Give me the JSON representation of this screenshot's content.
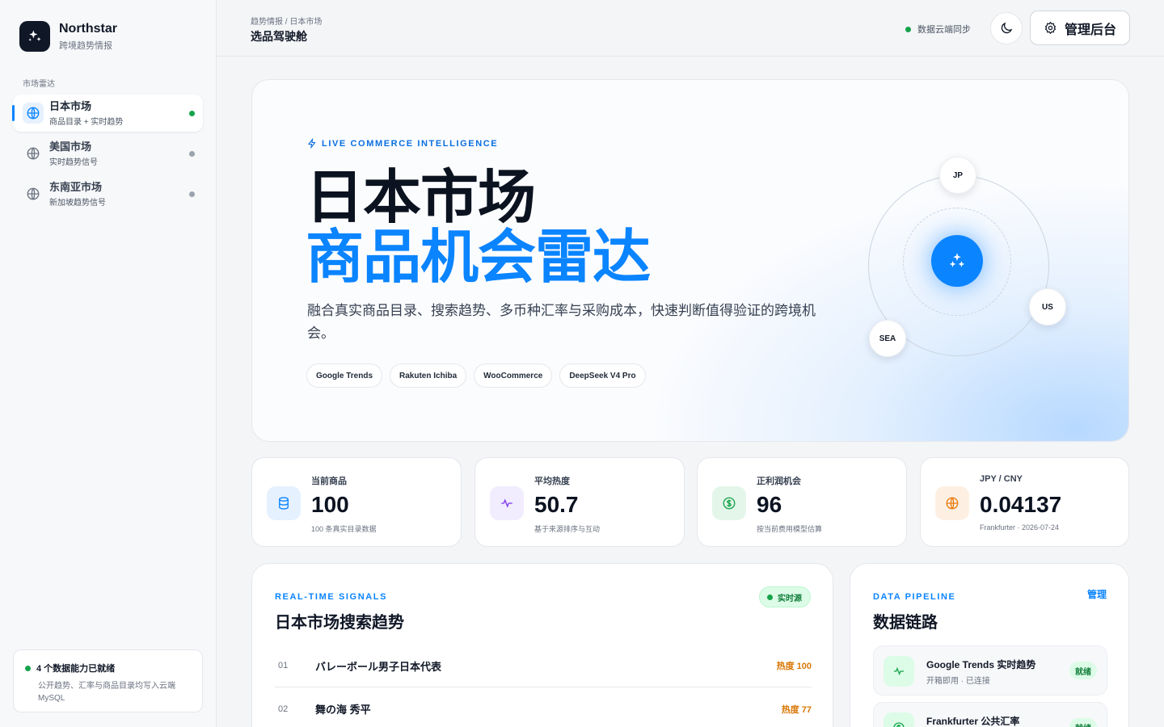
{
  "brand": {
    "name": "Northstar",
    "subtitle": "跨境趋势情报"
  },
  "sidebar": {
    "section_label": "市场雷达",
    "items": [
      {
        "label": "日本市场",
        "desc": "商品目录 + 实时趋势",
        "icon": "globe-icon",
        "active": true
      },
      {
        "label": "美国市场",
        "desc": "实时趋势信号",
        "icon": "globe-icon",
        "active": false
      },
      {
        "label": "东南亚市场",
        "desc": "新加坡趋势信号",
        "icon": "globe-icon",
        "active": false
      }
    ],
    "status": {
      "title": "4 个数据能力已就绪",
      "desc": "公开趋势、汇率与商品目录均写入云端 MySQL"
    }
  },
  "topbar": {
    "breadcrumb": "趋势情报 / 日本市场",
    "title": "选品驾驶舱",
    "sync_label": "数据云端同步",
    "admin_label": "管理后台"
  },
  "hero": {
    "kicker": "LIVE COMMERCE INTELLIGENCE",
    "title_line1": "日本市场",
    "title_line2": "商品机会雷达",
    "description": "融合真实商品目录、搜索趋势、多币种汇率与采购成本，快速判断值得验证的跨境机会。",
    "chips": [
      "Google Trends",
      "Rakuten Ichiba",
      "WooCommerce",
      "DeepSeek V4 Pro"
    ],
    "orbit_nodes": [
      "JP",
      "US",
      "SEA"
    ]
  },
  "stats": [
    {
      "label": "当前商品",
      "value": "100",
      "note": "100 条真实目录数据",
      "icon": "database-icon",
      "color": "#0a84ff",
      "bg": "#e6f1ff"
    },
    {
      "label": "平均热度",
      "value": "50.7",
      "note": "基于来源排序与互动",
      "icon": "pulse-icon",
      "color": "#7c3aed",
      "bg": "#f1ecfe"
    },
    {
      "label": "正利润机会",
      "value": "96",
      "note": "按当前费用模型估算",
      "icon": "dollar-icon",
      "color": "#16a34a",
      "bg": "#e4f6ea"
    },
    {
      "label": "JPY / CNY",
      "value": "0.04137",
      "note": "Frankfurter · 2026-07-24",
      "icon": "globe-icon",
      "color": "#ea7a0c",
      "bg": "#fdf0e3"
    }
  ],
  "signals": {
    "kicker": "REAL-TIME SIGNALS",
    "title": "日本市场搜索趋势",
    "badge": "实时源",
    "rows": [
      {
        "rank": "01",
        "name": "バレーボール男子日本代表",
        "heat": "热度 100"
      },
      {
        "rank": "02",
        "name": "舞の海 秀平",
        "heat": "热度 77"
      }
    ]
  },
  "pipeline": {
    "kicker": "DATA PIPELINE",
    "title": "数据链路",
    "manage_label": "管理",
    "items": [
      {
        "name": "Google Trends 实时趋势",
        "desc": "开箱即用 · 已连接",
        "status": "就绪",
        "icon": "pulse-icon"
      },
      {
        "name": "Frankfurter 公共汇率",
        "desc": "",
        "status": "就绪",
        "icon": "dollar-icon"
      }
    ]
  },
  "colors": {
    "accent": "#0a84ff",
    "success": "#16a34a",
    "heat": "#d97706",
    "ink": "#0b1220"
  }
}
